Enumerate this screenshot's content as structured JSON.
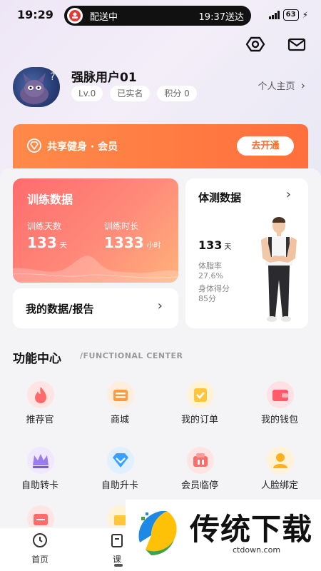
{
  "status_bar": {
    "time": "19:29",
    "pill_left": "配送中",
    "pill_right": "19:37送达",
    "battery": "63"
  },
  "profile": {
    "username": "强脉用户01",
    "tags": [
      "Lv.0",
      "已实名",
      "积分 0"
    ],
    "home_link": "个人主页",
    "chevron": "›"
  },
  "member": {
    "label": "共享健身 · 会员",
    "button": "去开通",
    "accent": "#ff6f3c"
  },
  "training": {
    "title": "训练数据",
    "days_label": "训练天数",
    "days_value": "133",
    "days_unit": "天",
    "duration_label": "训练时长",
    "duration_value": "1333",
    "duration_unit": "小时"
  },
  "my_data": {
    "label": "我的数据/报告",
    "chevron": "›"
  },
  "body_test": {
    "title": "体测数据",
    "chevron": "›",
    "days_value": "133",
    "days_unit": "天",
    "fat_label": "体脂率",
    "fat_value": "27.6%",
    "score_label": "身体得分",
    "score_value": "85分"
  },
  "function_center": {
    "title": "功能中心",
    "subtitle": "/FUNCTIONAL CENTER",
    "items": [
      {
        "label": "推荐官",
        "icon": "flame-icon",
        "color": "#ff6b6b"
      },
      {
        "label": "商城",
        "icon": "shop-icon",
        "color": "#ff9a3c"
      },
      {
        "label": "我的订单",
        "icon": "order-icon",
        "color": "#ffc53d"
      },
      {
        "label": "我的钱包",
        "icon": "wallet-icon",
        "color": "#ff5b6b"
      },
      {
        "label": "自助转卡",
        "icon": "crown-icon",
        "color": "#9b7cf0"
      },
      {
        "label": "自助升卡",
        "icon": "diamond-icon",
        "color": "#3aa0ff"
      },
      {
        "label": "会员临停",
        "icon": "pause-card-icon",
        "color": "#ff6b6b"
      },
      {
        "label": "人脸绑定",
        "icon": "face-icon",
        "color": "#ffb020"
      }
    ]
  },
  "tab_bar": {
    "home": "首页",
    "course": "课"
  },
  "watermark": {
    "text": "传统下载",
    "url": "ctdown.com"
  }
}
